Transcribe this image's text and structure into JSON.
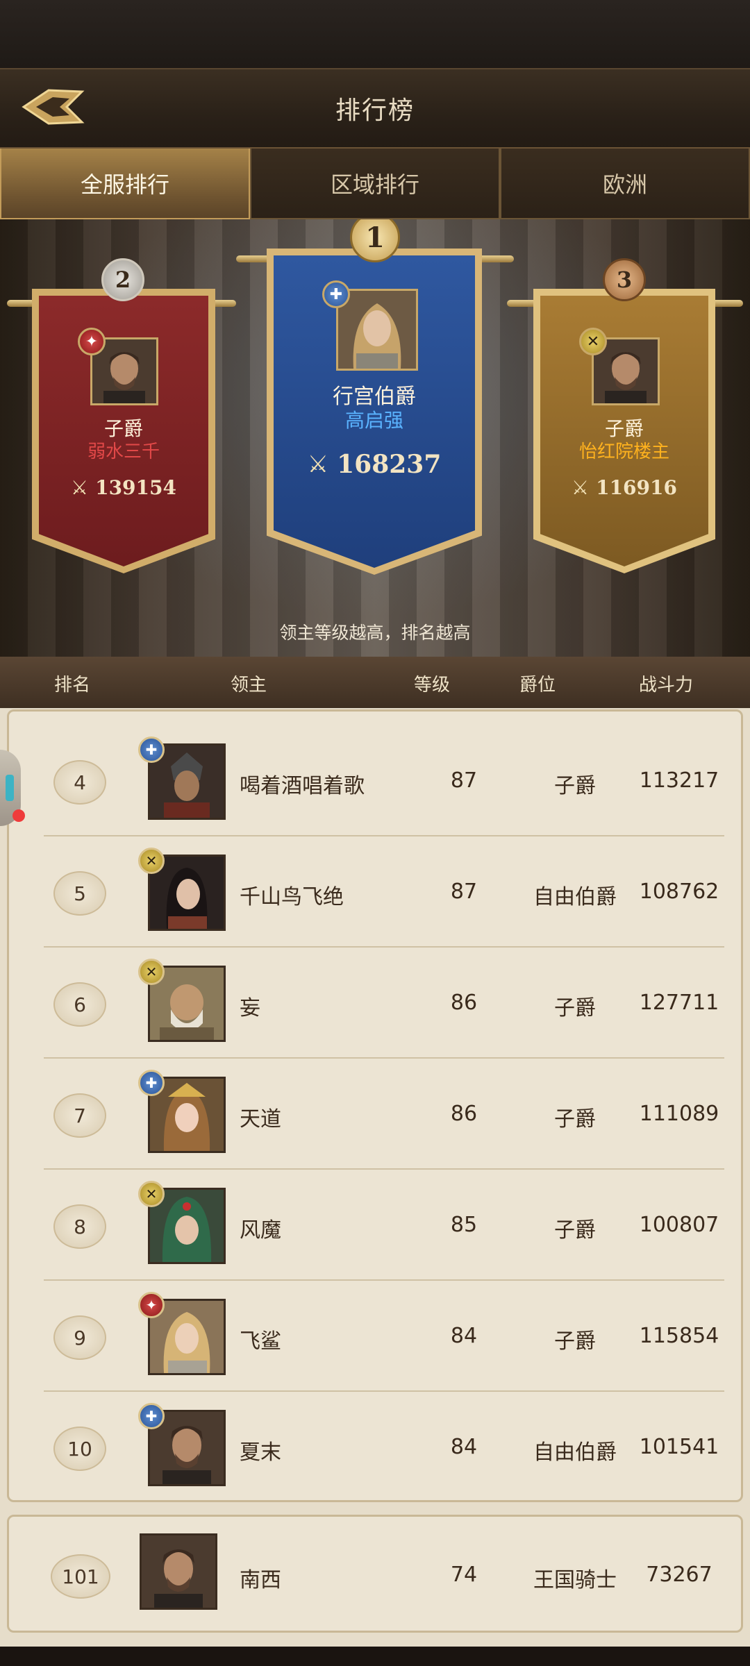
{
  "header": {
    "title": "排行榜"
  },
  "tabs": [
    {
      "label": "全服排行",
      "active": true
    },
    {
      "label": "区域排行",
      "active": false
    },
    {
      "label": "欧洲",
      "active": false
    }
  ],
  "podium": {
    "first": {
      "rank": "1",
      "title": "行宫伯爵",
      "name": "高启强",
      "power": "168237",
      "faction": "blue"
    },
    "second": {
      "rank": "2",
      "title": "子爵",
      "name": "弱水三千",
      "power": "139154",
      "faction": "red"
    },
    "third": {
      "rank": "3",
      "title": "子爵",
      "name": "怡红院楼主",
      "power": "116916",
      "faction": "gold"
    },
    "hint": "领主等级越高，排名越高"
  },
  "columns": {
    "rank": "排名",
    "lord": "领主",
    "level": "等级",
    "title": "爵位",
    "power": "战斗力"
  },
  "rows": [
    {
      "rank": "4",
      "name": "喝着酒唱着歌",
      "level": "87",
      "title": "子爵",
      "power": "113217",
      "faction": "blue"
    },
    {
      "rank": "5",
      "name": "千山鸟飞绝",
      "level": "87",
      "title": "自由伯爵",
      "power": "108762",
      "faction": "gold"
    },
    {
      "rank": "6",
      "name": "妄",
      "level": "86",
      "title": "子爵",
      "power": "127711",
      "faction": "gold"
    },
    {
      "rank": "7",
      "name": "天道",
      "level": "86",
      "title": "子爵",
      "power": "111089",
      "faction": "blue"
    },
    {
      "rank": "8",
      "name": "风魔",
      "level": "85",
      "title": "子爵",
      "power": "100807",
      "faction": "gold"
    },
    {
      "rank": "9",
      "name": "飞鲨",
      "level": "84",
      "title": "子爵",
      "power": "115854",
      "faction": "red"
    },
    {
      "rank": "10",
      "name": "夏末",
      "level": "84",
      "title": "自由伯爵",
      "power": "101541",
      "faction": "blue"
    }
  ],
  "me": {
    "rank": "101",
    "name": "南西",
    "level": "74",
    "title": "王国骑士",
    "power": "73267"
  },
  "colors": {
    "red_banner": "#7d2224",
    "blue_banner": "#27498c",
    "gold_banner": "#926a2b",
    "tab_active": "#8a6a3a",
    "list_bg": "#ece4d3"
  }
}
